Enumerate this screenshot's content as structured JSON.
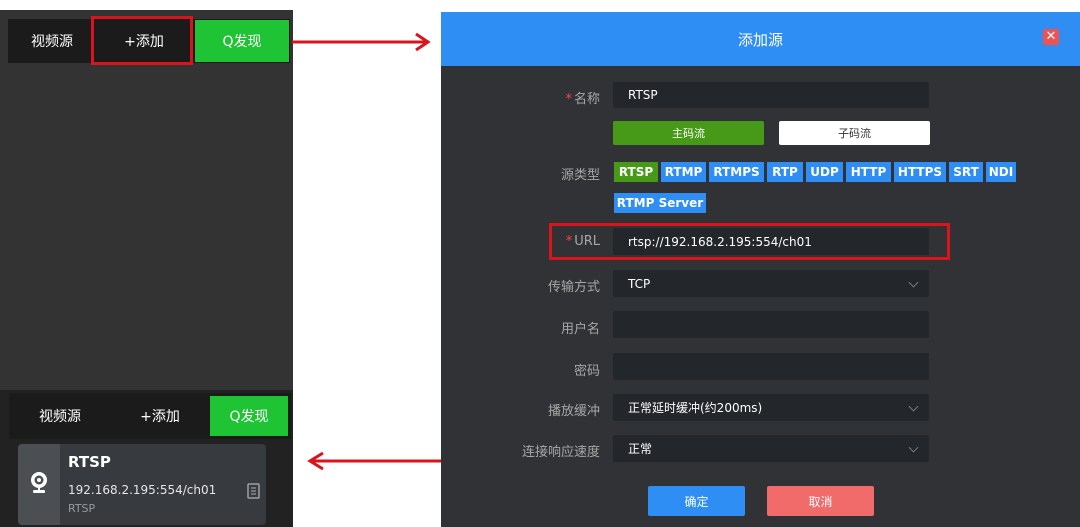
{
  "left_panel": {
    "tabs": [
      {
        "label": "视频源"
      },
      {
        "label": "+添加"
      },
      {
        "label": "Q发现"
      }
    ],
    "source_card": {
      "title": "RTSP",
      "url": "192.168.2.195:554/ch01",
      "type": "RTSP"
    }
  },
  "dialog": {
    "title": "添加源",
    "close_icon": "close-icon",
    "name": {
      "label": "名称",
      "value": "RTSP"
    },
    "stream_buttons": {
      "main": "主码流",
      "sub": "子码流"
    },
    "source_type": {
      "label": "源类型",
      "options": [
        "RTSP",
        "RTMP",
        "RTMPS",
        "RTP",
        "UDP",
        "HTTP",
        "HTTPS",
        "SRT",
        "NDI",
        "RTMP Server"
      ],
      "selected": "RTSP"
    },
    "url": {
      "label": "URL",
      "value": "rtsp://192.168.2.195:554/ch01"
    },
    "transport": {
      "label": "传输方式",
      "value": "TCP"
    },
    "username": {
      "label": "用户名",
      "value": ""
    },
    "password": {
      "label": "密码",
      "value": ""
    },
    "buffer": {
      "label": "播放缓冲",
      "value": "正常延时缓冲(约200ms)"
    },
    "response_speed": {
      "label": "连接响应速度",
      "value": "正常"
    },
    "ok_label": "确定",
    "cancel_label": "取消"
  },
  "colors": {
    "accent_blue": "#2f8ef4",
    "green": "#1ec433",
    "dark_green": "#479a18",
    "highlight_red": "#d9141c",
    "cancel_red": "#f16b6b"
  }
}
